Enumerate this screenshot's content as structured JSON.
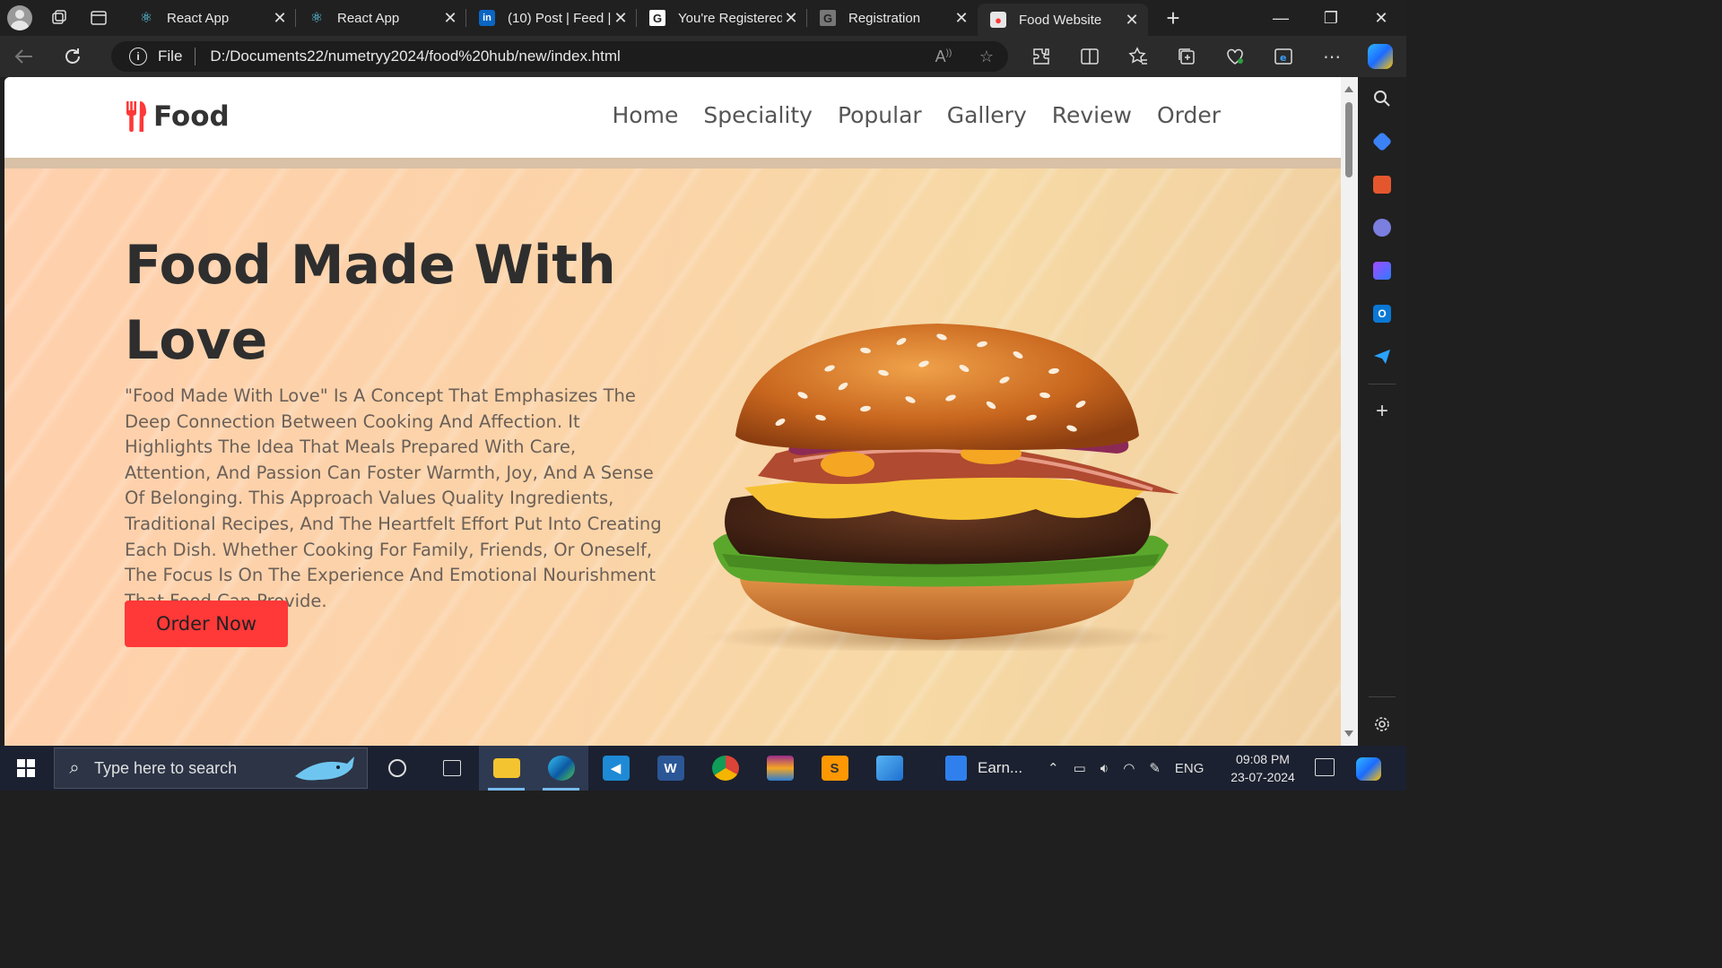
{
  "browser": {
    "tabs": [
      {
        "title": "React App",
        "icon": "react-icon"
      },
      {
        "title": "React App",
        "icon": "react-icon"
      },
      {
        "title": "(10) Post | Feed |",
        "icon": "linkedin-icon"
      },
      {
        "title": "You're Registered",
        "icon": "g-icon"
      },
      {
        "title": "Registration",
        "icon": "g-icon"
      },
      {
        "title": "Food Website",
        "icon": "food-icon",
        "active": true
      }
    ],
    "address": {
      "scheme_label": "File",
      "url": "D:/Documents22/numetryy2024/food%20hub/new/index.html"
    }
  },
  "site": {
    "logo_text": "Food",
    "nav": [
      "Home",
      "Speciality",
      "Popular",
      "Gallery",
      "Review",
      "Order"
    ],
    "hero": {
      "heading": "Food Made With Love",
      "body": "\"Food Made With Love\" Is A Concept That Emphasizes The Deep Connection Between Cooking And Affection. It Highlights The Idea That Meals Prepared With Care, Attention, And Passion Can Foster Warmth, Joy, And A Sense Of Belonging. This Approach Values Quality Ingredients, Traditional Recipes, And The Heartfelt Effort Put Into Creating Each Dish. Whether Cooking For Family, Friends, Or Oneself, The Focus Is On The Experience And Emotional Nourishment That Food Can Provide.",
      "cta_label": "Order Now"
    },
    "colors": {
      "accent": "#ff3838",
      "heading": "#2e2e2e",
      "text": "#6b6058"
    }
  },
  "taskbar": {
    "search_placeholder": "Type here to search",
    "running_app_label": "Earn...",
    "language": "ENG",
    "time": "09:08 PM",
    "date": "23-07-2024"
  }
}
